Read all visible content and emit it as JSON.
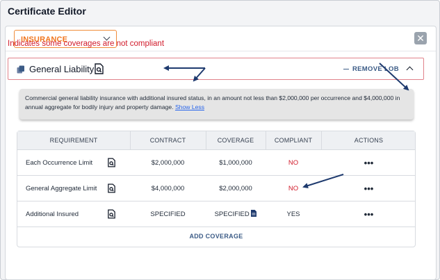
{
  "app": {
    "title": "Certificate Editor"
  },
  "header": {
    "selected_type": "INSURANCE",
    "close_symbol": "✕"
  },
  "warning_text": "Indicates some coverages are not compliant",
  "lob": {
    "title": "General Liability",
    "remove_label": "REMOVE LOB",
    "description": "Commercial general liability insurance with additional insured status, in an amount not less than $2,000,000 per occurrence and $4,000,000 in annual aggregate for bodily injury and property damage.",
    "show_less": "Show Less"
  },
  "table": {
    "headers": {
      "requirement": "REQUIREMENT",
      "contract": "CONTRACT",
      "coverage": "COVERAGE",
      "compliant": "COMPLIANT",
      "actions": "ACTIONS"
    },
    "rows": [
      {
        "requirement": "Each Occurrence Limit",
        "contract": "$2,000,000",
        "coverage": "$1,000,000",
        "compliant": "NO",
        "actions": "•••"
      },
      {
        "requirement": "General Aggregate Limit",
        "contract": "$4,000,000",
        "coverage": "$2,000,000",
        "compliant": "NO",
        "actions": "•••"
      },
      {
        "requirement": "Additional Insured",
        "contract": "SPECIFIED",
        "coverage": "SPECIFIED",
        "compliant": "YES",
        "actions": "•••"
      }
    ],
    "add_label": "ADD COVERAGE"
  },
  "colors": {
    "accent_orange": "#f0761f",
    "error_red": "#d11a2a",
    "link_blue": "#3b5b86",
    "annotation_arrow": "#1e3a6e"
  }
}
